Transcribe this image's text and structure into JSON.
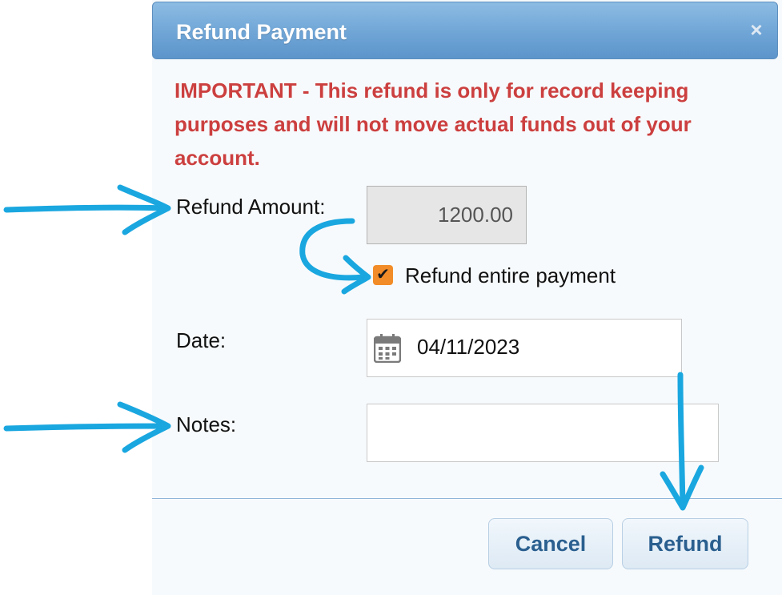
{
  "dialog": {
    "title": "Refund Payment",
    "close_label": "×",
    "warning": "IMPORTANT - This refund is only for record keeping purposes and will not move actual funds out of your account."
  },
  "form": {
    "amount_label": "Refund Amount:",
    "amount_value": "1200.00",
    "entire_payment_label": "Refund entire payment",
    "entire_payment_checked": true,
    "date_label": "Date:",
    "date_value": "04/11/2023",
    "notes_label": "Notes:",
    "notes_value": ""
  },
  "buttons": {
    "cancel": "Cancel",
    "refund": "Refund"
  },
  "colors": {
    "warning": "#cc3f3f",
    "checkbox": "#f28c28",
    "titlebar": "#6fa5d6",
    "annotation": "#1aa7e0"
  }
}
